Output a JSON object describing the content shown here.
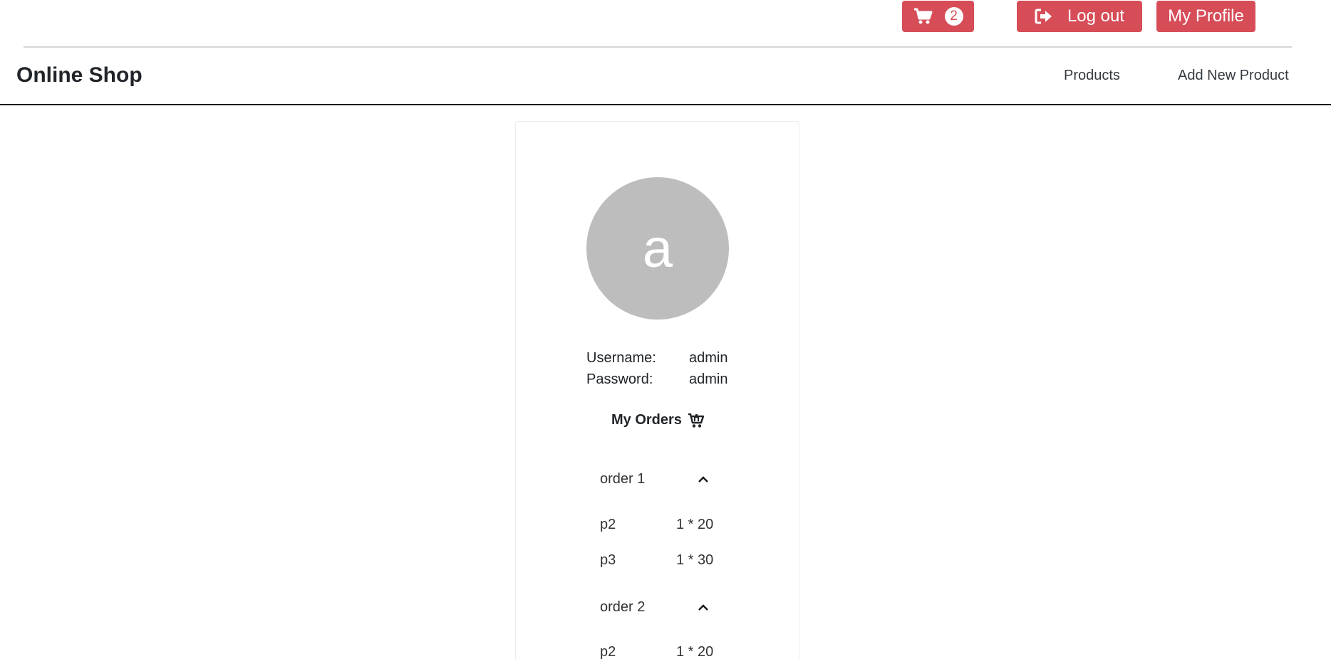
{
  "topbar": {
    "cart_count": "2",
    "logout_label": "Log out",
    "profile_label": "My Profile"
  },
  "navbar": {
    "brand": "Online Shop",
    "links": [
      "Products",
      "Add New Product"
    ]
  },
  "profile": {
    "avatar_letter": "a",
    "username_label": "Username:",
    "username": "admin",
    "password_label": "Password:",
    "password": "admin",
    "orders_title": "My Orders"
  },
  "orders": [
    {
      "name": "order 1",
      "items": [
        {
          "product": "p2",
          "qty": "1 * 20"
        },
        {
          "product": "p3",
          "qty": "1 * 30"
        }
      ]
    },
    {
      "name": "order 2",
      "items": [
        {
          "product": "p2",
          "qty": "1 * 20"
        }
      ]
    }
  ],
  "colors": {
    "accent": "#d64d58",
    "avatar_bg": "#bdbdbd"
  },
  "icons": [
    "cart-icon",
    "logout-icon",
    "chevron-up-icon"
  ]
}
